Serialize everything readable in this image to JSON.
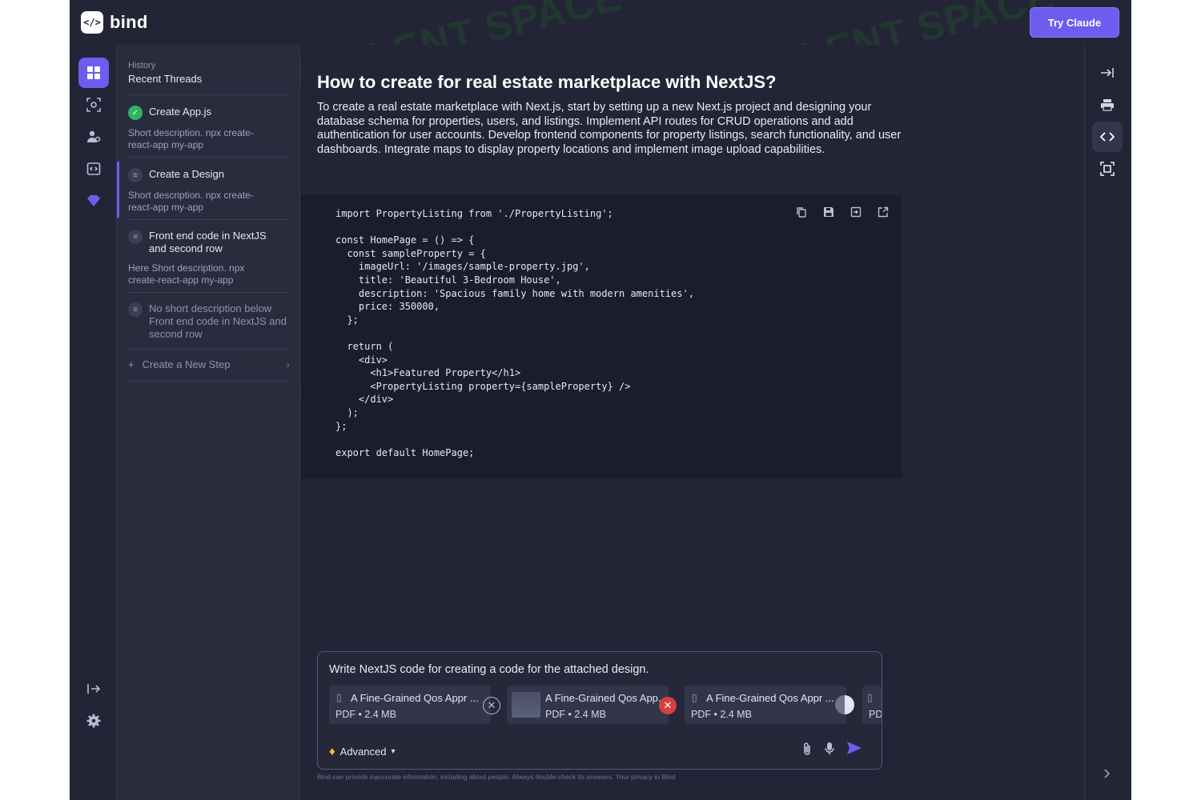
{
  "app": {
    "logo_mark": "</>",
    "logo_text": "bind",
    "cta_label": "Try Claude"
  },
  "rail": {
    "icons": [
      "grid-icon",
      "scan-icon",
      "users-icon",
      "code-box-icon",
      "gem-icon"
    ],
    "bottom_icons": [
      "collapse-arrow-icon",
      "settings-icon"
    ]
  },
  "history": {
    "section": "History",
    "title": "Recent Threads",
    "threads": [
      {
        "title": "Create App.js",
        "desc": "Short description. npx create-react-app my-app",
        "status": "done"
      },
      {
        "title": "Create a Design",
        "desc": "Short description. npx create-react-app my-app",
        "status": "pending"
      },
      {
        "title": "Front end code in NextJS and second row",
        "desc": "Here Short description. npx create-react-app my-app",
        "status": "pending"
      },
      {
        "title": "No short description below Front end code in NextJS and second row",
        "desc": "",
        "status": "muted"
      }
    ],
    "new_step": "Create a New Step"
  },
  "main": {
    "question": "How to create for real estate marketplace with NextJS?",
    "answer": "To create a real estate marketplace with Next.js, start by setting up a new Next.js project and designing your database schema for properties, users, and listings. Implement API routes for CRUD operations and add authentication for user accounts. Develop frontend components for property listings, search functionality, and user dashboards. Integrate maps to display property locations and implement image upload capabilities.",
    "code": "import PropertyListing from './PropertyListing';\n\nconst HomePage = () => {\n  const sampleProperty = {\n    imageUrl: '/images/sample-property.jpg',\n    title: 'Beautiful 3-Bedroom House',\n    description: 'Spacious family home with modern amenities',\n    price: 350000,\n  };\n\n  return (\n    <div>\n      <h1>Featured Property</h1>\n      <PropertyListing property={sampleProperty} />\n    </div>\n  );\n};\n\nexport default HomePage;",
    "code_tools": [
      "copy-icon",
      "save-icon",
      "export-icon",
      "open-external-icon"
    ]
  },
  "composer": {
    "prompt": "Write NextJS code for creating a code for the attached design.",
    "attachments": [
      {
        "name": "A Fine-Grained Qos Appr ...",
        "meta": "PDF • 2.4 MB",
        "state": "ready"
      },
      {
        "name": "A Fine-Grained Qos App...",
        "meta": "PDF • 2.4 MB",
        "state": "error"
      },
      {
        "name": "A Fine-Grained Qos Appr ...",
        "meta": "PDF • 2.4 MB",
        "state": "uploading",
        "progress": 0.5
      },
      {
        "name": "",
        "meta": "PD",
        "state": "partial"
      }
    ],
    "mode_label": "Advanced",
    "disclaimer": "Bind can provide inaccurate information, including about people. Always double-check its answers. Your privacy in Bind"
  },
  "right_rail": {
    "icons": [
      "collapse-right-icon",
      "printer-icon",
      "code-icon",
      "screenshot-icon",
      "chevron-right-icon"
    ]
  },
  "watermark": "AI TALENT SPACE",
  "colors": {
    "accent": "#6e5cf0",
    "background": "#232536",
    "panel": "#2a2c3e",
    "code_bg": "#1b1d2b",
    "success": "#2fb562",
    "error": "#d64040"
  }
}
